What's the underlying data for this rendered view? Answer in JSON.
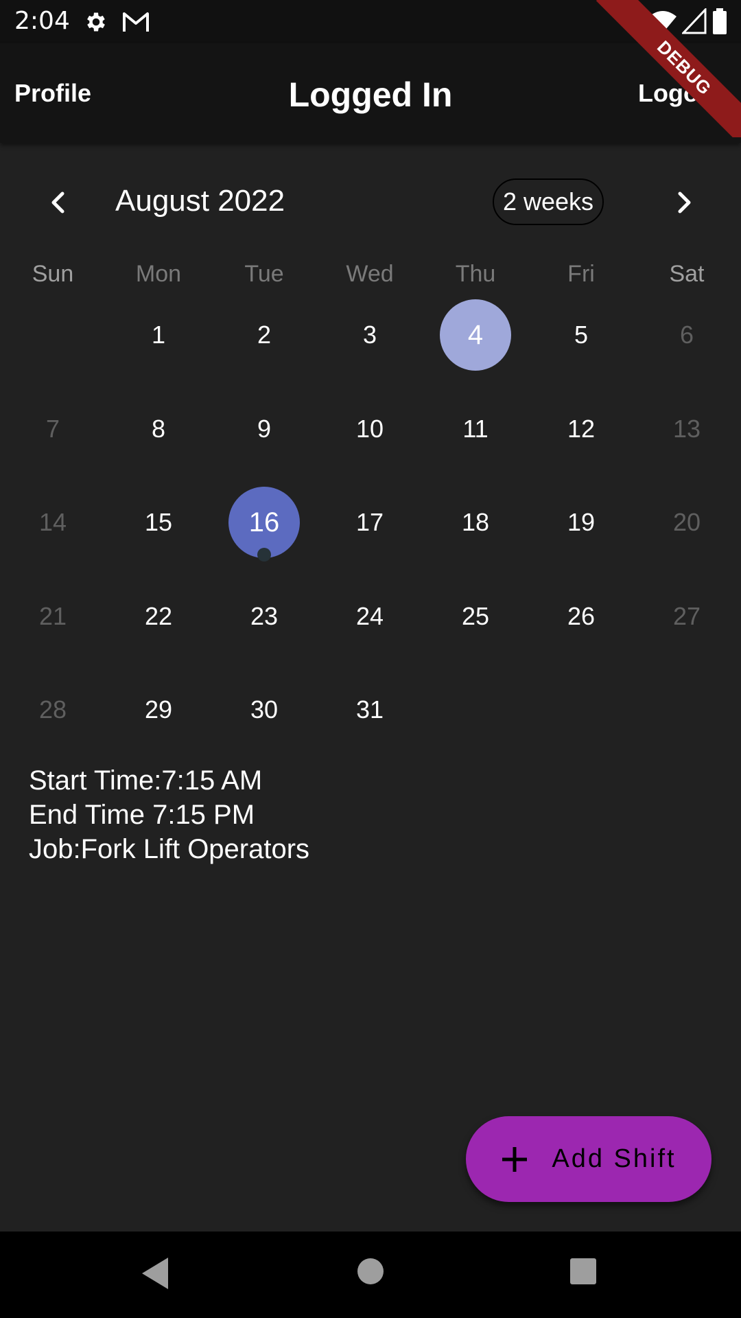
{
  "status_bar": {
    "time": "2:04",
    "icons": [
      "gear-icon",
      "gmail-icon",
      "wifi-icon",
      "signal-icon",
      "battery-icon"
    ]
  },
  "app_bar": {
    "profile_label": "Profile",
    "title": "Logged In",
    "logout_label": "Logout",
    "debug_banner": "DEBUG"
  },
  "calendar": {
    "month_title": "August 2022",
    "format_button": "2 weeks",
    "weekdays": [
      "Sun",
      "Mon",
      "Tue",
      "Wed",
      "Thu",
      "Fri",
      "Sat"
    ],
    "first_weekday_index": 1,
    "days_in_month": 31,
    "today": 4,
    "selected": 16,
    "event_marker_days": [
      16
    ]
  },
  "event": {
    "start": "Start Time:7:15 AM",
    "end": "End Time 7:15 PM",
    "job": "Job:Fork Lift Operators"
  },
  "fab": {
    "label": "Add Shift",
    "icon": "plus-icon"
  },
  "colors": {
    "background": "#212121",
    "app_bar": "#141414",
    "today_circle": "#9fa8da",
    "selected_circle": "#5c6bc0",
    "fab": "#9c27b0",
    "weekend_text": "#5f5f5f"
  }
}
